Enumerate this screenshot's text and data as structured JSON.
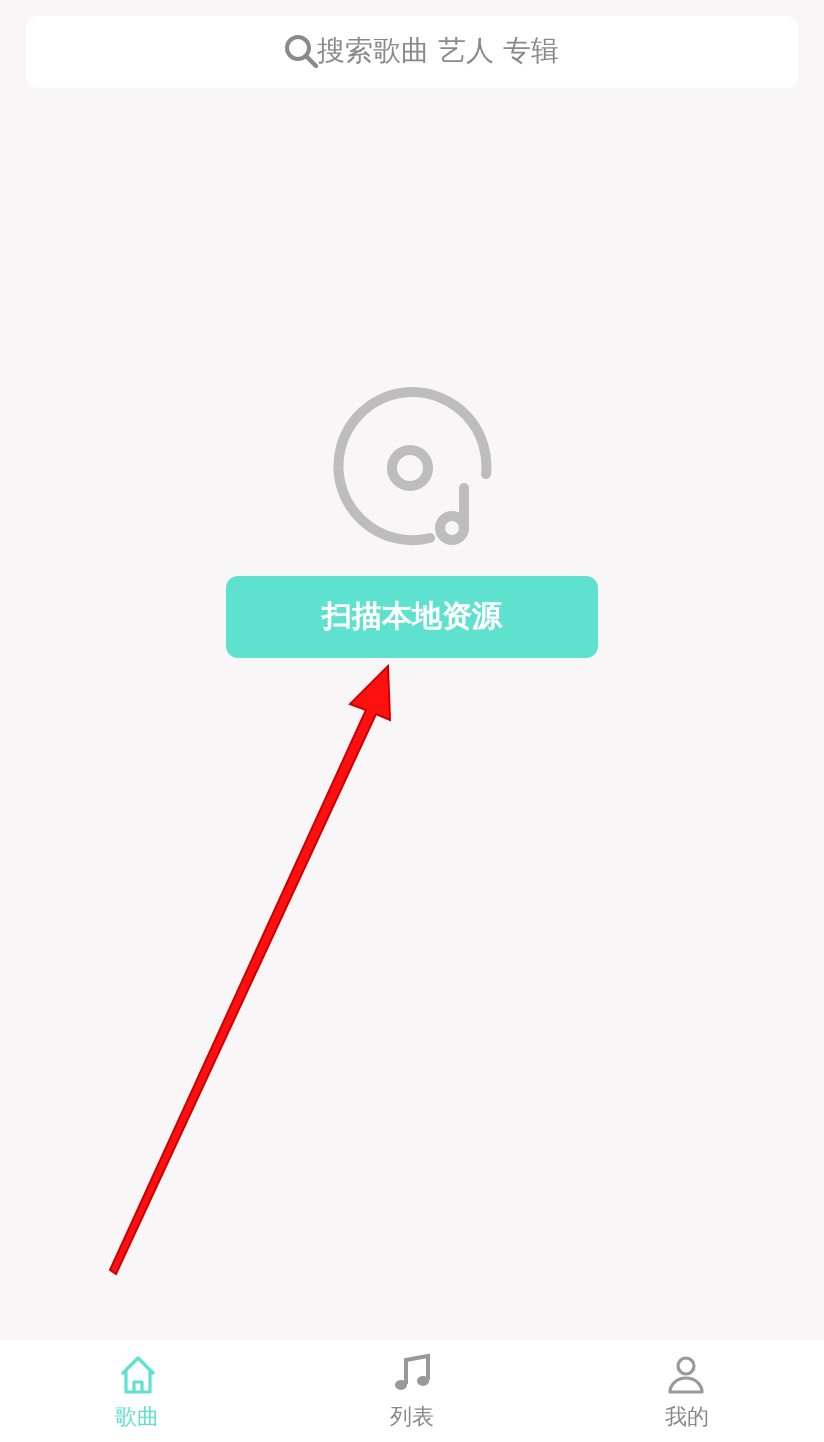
{
  "search": {
    "placeholder": "搜索歌曲 艺人 专辑"
  },
  "empty_state": {
    "button": "扫描本地资源"
  },
  "annotation": {
    "kind": "arrow"
  },
  "tab_bar": [
    {
      "label": "歌曲",
      "kind": "home",
      "selected": true
    },
    {
      "label": "列表",
      "kind": "music",
      "selected": false
    },
    {
      "label": "我的",
      "kind": "person",
      "selected": false
    }
  ]
}
